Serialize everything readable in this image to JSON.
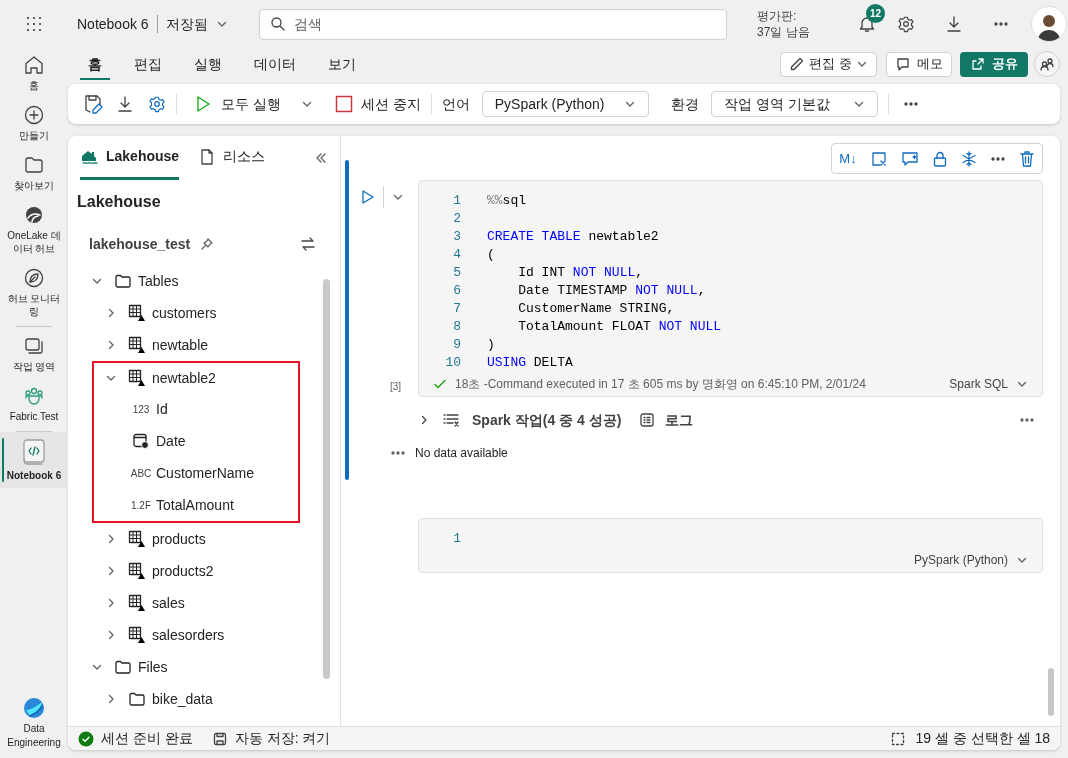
{
  "header": {
    "notebook_title": "Notebook 6",
    "save_state": "저장됨",
    "search_placeholder": "검색",
    "trial_label": "평가판:",
    "trial_remaining": "37일 남음",
    "notification_count": "12"
  },
  "nav": [
    {
      "label": "홈",
      "kind": "home",
      "selected": false
    },
    {
      "label": "만들기",
      "kind": "create",
      "selected": false
    },
    {
      "label": "찾아보기",
      "kind": "browse",
      "selected": false
    },
    {
      "label": "OneLake 데이터 허브",
      "kind": "onelake",
      "selected": false
    },
    {
      "label": "허브 모니터링",
      "kind": "monitor",
      "selected": false
    },
    {
      "label": "작업 영역",
      "kind": "workspaces",
      "selected": false
    },
    {
      "label": "Fabric Test",
      "kind": "team",
      "selected": false
    },
    {
      "label": "Notebook 6",
      "kind": "notebook",
      "selected": true
    }
  ],
  "nav_footer": {
    "label": "Data Engineering"
  },
  "ribbon_tabs": [
    {
      "label": "홈",
      "selected": true
    },
    {
      "label": "편집",
      "selected": false
    },
    {
      "label": "실행",
      "selected": false
    },
    {
      "label": "데이터",
      "selected": false
    },
    {
      "label": "보기",
      "selected": false
    }
  ],
  "ribbon_actions": {
    "edit_mode": "편집 중",
    "memo": "메모",
    "share": "공유"
  },
  "toolbar": {
    "run_all": "모두 실행",
    "stop_session": "세션 중지",
    "language_label": "언어",
    "language": "PySpark (Python)",
    "environment_label": "환경",
    "environment": "작업 영역 기본값"
  },
  "explorer": {
    "tabs": [
      {
        "label": "Lakehouse",
        "kind": "lakehouse",
        "selected": true
      },
      {
        "label": "리소스",
        "kind": "file",
        "selected": false
      }
    ],
    "heading": "Lakehouse",
    "lakehouse_name": "lakehouse_test",
    "tree": [
      {
        "label": "Tables",
        "kind": "folder",
        "expanded": true,
        "children": [
          {
            "label": "customers",
            "kind": "table",
            "expanded": false,
            "highlighted": false
          },
          {
            "label": "newtable",
            "kind": "table",
            "expanded": false,
            "highlighted": false
          },
          {
            "label": "newtable2",
            "kind": "table",
            "expanded": true,
            "highlighted": true,
            "children": [
              {
                "label": "Id",
                "kind": "column",
                "type_label": "123"
              },
              {
                "label": "Date",
                "kind": "date-column"
              },
              {
                "label": "CustomerName",
                "kind": "column",
                "type_label": "ABC"
              },
              {
                "label": "TotalAmount",
                "kind": "column",
                "type_label": "1.2F"
              }
            ]
          },
          {
            "label": "products",
            "kind": "table",
            "expanded": false,
            "highlighted": false
          },
          {
            "label": "products2",
            "kind": "table",
            "expanded": false,
            "highlighted": false
          },
          {
            "label": "sales",
            "kind": "table",
            "expanded": false,
            "highlighted": false
          },
          {
            "label": "salesorders",
            "kind": "table",
            "expanded": false,
            "highlighted": false
          }
        ]
      },
      {
        "label": "Files",
        "kind": "folder",
        "expanded": true,
        "children": [
          {
            "label": "bike_data",
            "kind": "folder",
            "expanded": false
          }
        ]
      }
    ]
  },
  "cell_toolbar": {
    "markdown_toggle": "M↓"
  },
  "cells": [
    {
      "selected": true,
      "exec_count": "[3]",
      "language": "Spark SQL",
      "lines": [
        {
          "n": "1",
          "tokens": [
            {
              "text": "%%",
              "kind": "magic"
            },
            {
              "text": "sql",
              "kind": "plain"
            }
          ]
        },
        {
          "n": "2"
        },
        {
          "n": "3",
          "tokens": [
            {
              "text": "CREATE TABLE",
              "kind": "keyword"
            },
            {
              "text": " newtable2",
              "kind": "plain"
            }
          ]
        },
        {
          "n": "4",
          "tokens": [
            {
              "text": "(",
              "kind": "plain"
            }
          ]
        },
        {
          "n": "5",
          "tokens": [
            {
              "text": "    Id INT ",
              "kind": "plain"
            },
            {
              "text": "NOT NULL",
              "kind": "keyword"
            },
            {
              "text": ",",
              "kind": "plain"
            }
          ]
        },
        {
          "n": "6",
          "tokens": [
            {
              "text": "    Date TIMESTAMP ",
              "kind": "plain"
            },
            {
              "text": "NOT NULL",
              "kind": "keyword"
            },
            {
              "text": ",",
              "kind": "plain"
            }
          ]
        },
        {
          "n": "7",
          "tokens": [
            {
              "text": "    CustomerName STRING,",
              "kind": "plain"
            }
          ]
        },
        {
          "n": "8",
          "tokens": [
            {
              "text": "    TotalAmount FLOAT ",
              "kind": "plain"
            },
            {
              "text": "NOT NULL",
              "kind": "keyword"
            }
          ]
        },
        {
          "n": "9",
          "tokens": [
            {
              "text": ")",
              "kind": "plain"
            }
          ]
        },
        {
          "n": "10",
          "tokens": [
            {
              "text": "USING",
              "kind": "keyword"
            },
            {
              "text": " DELTA",
              "kind": "plain"
            }
          ]
        }
      ],
      "status": "18초 -Command executed in 17 초 605 ms by 명화영 on 6:45:10 PM, 2/01/24",
      "jobs": "Spark 작업(4 중 4 성공)",
      "log": "로그",
      "output": "No data available"
    },
    {
      "selected": false,
      "language": "PySpark (Python)",
      "lines": [
        {
          "n": "1"
        }
      ]
    }
  ],
  "status_bar": {
    "session": "세션 준비 완료",
    "autosave": "자동 저장: 켜기",
    "selection": "19 셀 중 선택한 셀 18"
  }
}
